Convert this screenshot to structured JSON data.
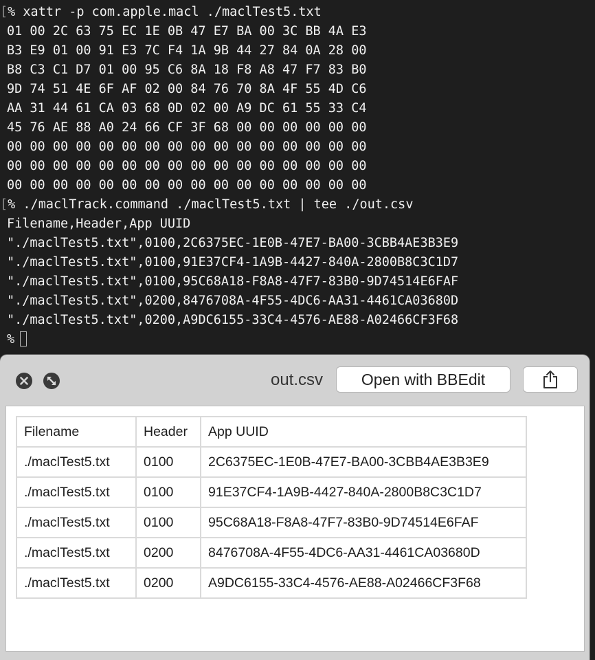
{
  "terminal": {
    "edge_mark": "[",
    "command1": "% xattr -p com.apple.macl ./maclTest5.txt",
    "hex_lines": [
      "01 00 2C 63 75 EC 1E 0B 47 E7 BA 00 3C BB 4A E3",
      "B3 E9 01 00 91 E3 7C F4 1A 9B 44 27 84 0A 28 00",
      "B8 C3 C1 D7 01 00 95 C6 8A 18 F8 A8 47 F7 83 B0",
      "9D 74 51 4E 6F AF 02 00 84 76 70 8A 4F 55 4D C6",
      "AA 31 44 61 CA 03 68 0D 02 00 A9 DC 61 55 33 C4",
      "45 76 AE 88 A0 24 66 CF 3F 68 00 00 00 00 00 00",
      "00 00 00 00 00 00 00 00 00 00 00 00 00 00 00 00",
      "00 00 00 00 00 00 00 00 00 00 00 00 00 00 00 00",
      "00 00 00 00 00 00 00 00 00 00 00 00 00 00 00 00"
    ],
    "command2": "% ./maclTrack.command ./maclTest5.txt | tee ./out.csv",
    "csv_lines": [
      "Filename,Header,App UUID",
      "\"./maclTest5.txt\",0100,2C6375EC-1E0B-47E7-BA00-3CBB4AE3B3E9",
      "\"./maclTest5.txt\",0100,91E37CF4-1A9B-4427-840A-2800B8C3C1D7",
      "\"./maclTest5.txt\",0100,95C68A18-F8A8-47F7-83B0-9D74514E6FAF",
      "\"./maclTest5.txt\",0200,8476708A-4F55-4DC6-AA31-4461CA03680D",
      "\"./maclTest5.txt\",0200,A9DC6155-33C4-4576-AE88-A02466CF3F68"
    ],
    "prompt": "%"
  },
  "quicklook": {
    "title": "out.csv",
    "open_button_label": "Open with BBEdit",
    "close_icon": "close-x-icon",
    "fullscreen_icon": "diagonal-arrows-icon",
    "share_icon": "share-icon",
    "table": {
      "headers": [
        "Filename",
        "Header",
        "App UUID"
      ],
      "rows": [
        [
          "./maclTest5.txt",
          "0100",
          "2C6375EC-1E0B-47E7-BA00-3CBB4AE3B3E9"
        ],
        [
          "./maclTest5.txt",
          "0100",
          "91E37CF4-1A9B-4427-840A-2800B8C3C1D7"
        ],
        [
          "./maclTest5.txt",
          "0100",
          "95C68A18-F8A8-47F7-83B0-9D74514E6FAF"
        ],
        [
          "./maclTest5.txt",
          "0200",
          "8476708A-4F55-4DC6-AA31-4461CA03680D"
        ],
        [
          "./maclTest5.txt",
          "0200",
          "A9DC6155-33C4-4576-AE88-A02466CF3F68"
        ]
      ]
    }
  }
}
